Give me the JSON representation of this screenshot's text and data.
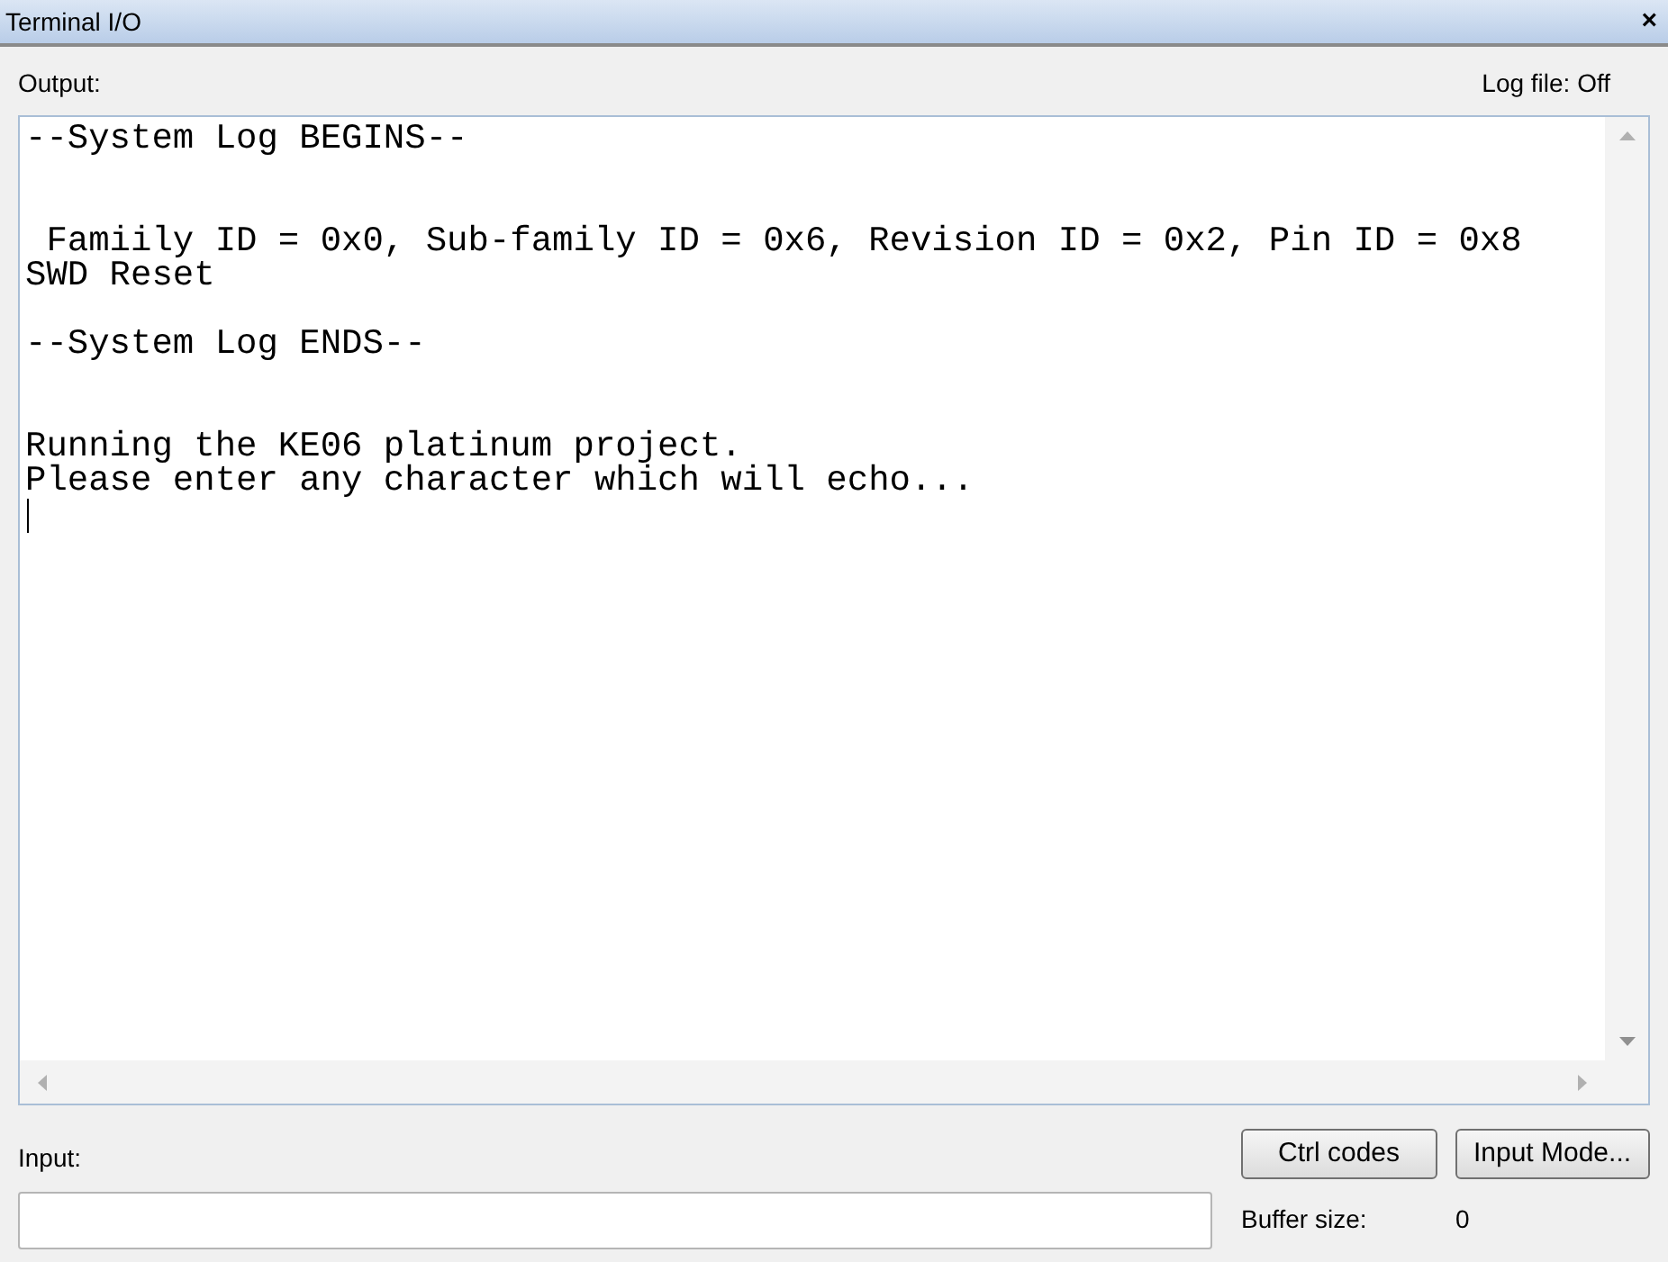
{
  "window": {
    "title": "Terminal I/O",
    "close": "×"
  },
  "output": {
    "label": "Output:",
    "log_file": "Log file: Off",
    "lines": [
      {
        "kind": "text",
        "text": "--System Log BEGINS--"
      },
      {
        "kind": "blank"
      },
      {
        "kind": "blank"
      },
      {
        "kind": "text",
        "text": " Famiily ID = 0x0, Sub-family ID = 0x6, Revision ID = 0x2, Pin ID = 0x8"
      },
      {
        "kind": "text",
        "text": "SWD Reset"
      },
      {
        "kind": "blank"
      },
      {
        "kind": "text",
        "text": "--System Log ENDS--"
      },
      {
        "kind": "blank"
      },
      {
        "kind": "blank"
      },
      {
        "kind": "text",
        "text": "Running the KE06 platinum project."
      },
      {
        "kind": "text",
        "text": "Please enter any character which will echo..."
      },
      {
        "kind": "cursor"
      }
    ]
  },
  "input": {
    "label": "Input:",
    "buttons": [
      "Ctrl codes",
      "Input Mode..."
    ],
    "buffer_label": "Buffer size:",
    "buffer_value": "0"
  }
}
